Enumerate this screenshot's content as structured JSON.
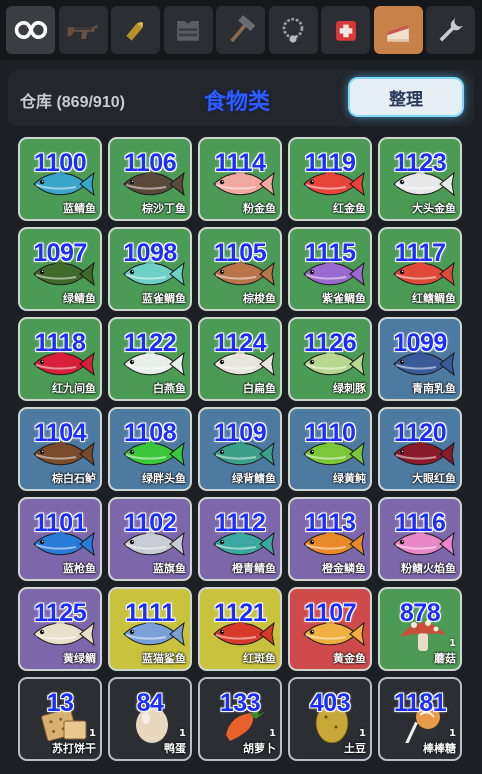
{
  "tabs": [
    {
      "name": "infinity",
      "icon": "infinity-icon"
    },
    {
      "name": "rifle",
      "icon": "rifle-icon"
    },
    {
      "name": "ammo",
      "icon": "bullet-icon"
    },
    {
      "name": "armor",
      "icon": "armor-vest-icon"
    },
    {
      "name": "tool",
      "icon": "hammer-icon"
    },
    {
      "name": "accessory",
      "icon": "necklace-icon"
    },
    {
      "name": "medicine",
      "icon": "medkit-icon"
    },
    {
      "name": "food",
      "icon": "cake-icon",
      "active": true
    },
    {
      "name": "misc",
      "icon": "wrench-icon"
    }
  ],
  "header": {
    "storage": "仓库 (869/910)",
    "category": "食物类",
    "sort_label": "整理"
  },
  "items": [
    {
      "id": "1100",
      "name": "蓝鲭鱼",
      "bg": "green",
      "color": "#3aa7c9"
    },
    {
      "id": "1106",
      "name": "棕沙丁鱼",
      "bg": "green",
      "color": "#5a4a3a"
    },
    {
      "id": "1114",
      "name": "粉金鱼",
      "bg": "green",
      "color": "#f0a8a0"
    },
    {
      "id": "1119",
      "name": "红金鱼",
      "bg": "green",
      "color": "#e8453a"
    },
    {
      "id": "1123",
      "name": "大头金鱼",
      "bg": "green",
      "color": "#e8e8e8"
    },
    {
      "id": "1097",
      "name": "绿鲭鱼",
      "bg": "green",
      "color": "#3f6a2a"
    },
    {
      "id": "1098",
      "name": "蓝雀鲷鱼",
      "bg": "green",
      "color": "#6fd0c8"
    },
    {
      "id": "1105",
      "name": "棕梭鱼",
      "bg": "green",
      "color": "#b8754a"
    },
    {
      "id": "1115",
      "name": "紫雀鲷鱼",
      "bg": "green",
      "color": "#9a6ad0"
    },
    {
      "id": "1117",
      "name": "红鳍鲷鱼",
      "bg": "green",
      "color": "#e04a3a"
    },
    {
      "id": "1118",
      "name": "红九间鱼",
      "bg": "green",
      "color": "#d8203a"
    },
    {
      "id": "1122",
      "name": "白燕鱼",
      "bg": "green",
      "color": "#e8eeea"
    },
    {
      "id": "1124",
      "name": "白扁鱼",
      "bg": "green",
      "color": "#e8e4de"
    },
    {
      "id": "1126",
      "name": "绿刺豚",
      "bg": "green",
      "color": "#b8d890"
    },
    {
      "id": "1099",
      "name": "青南乳鱼",
      "bg": "blue",
      "color": "#3a5a9a"
    },
    {
      "id": "1104",
      "name": "棕白石鲈",
      "bg": "blue",
      "color": "#7a4a2a"
    },
    {
      "id": "1108",
      "name": "绿胖头鱼",
      "bg": "blue",
      "color": "#3ac83a"
    },
    {
      "id": "1109",
      "name": "绿背鳍鱼",
      "bg": "blue",
      "color": "#3aa08a"
    },
    {
      "id": "1110",
      "name": "绿黄鲀",
      "bg": "blue",
      "color": "#7ac83a"
    },
    {
      "id": "1120",
      "name": "大眼红鱼",
      "bg": "blue",
      "color": "#8a1a2a"
    },
    {
      "id": "1101",
      "name": "蓝枪鱼",
      "bg": "purple",
      "color": "#2a7ad8"
    },
    {
      "id": "1102",
      "name": "蓝旗鱼",
      "bg": "purple",
      "color": "#c8ccd4"
    },
    {
      "id": "1112",
      "name": "橙青鲭鱼",
      "bg": "purple",
      "color": "#3aa8a0"
    },
    {
      "id": "1113",
      "name": "橙金鳞鱼",
      "bg": "purple",
      "color": "#e88a2a"
    },
    {
      "id": "1116",
      "name": "粉鳍火焰鱼",
      "bg": "purple",
      "color": "#e888c8"
    },
    {
      "id": "1125",
      "name": "黄绿鲷",
      "bg": "purple",
      "color": "#e8e0c8"
    },
    {
      "id": "1111",
      "name": "蓝猫鲨鱼",
      "bg": "yellow",
      "color": "#7aa0d8"
    },
    {
      "id": "1121",
      "name": "红斑鱼",
      "bg": "yellow",
      "color": "#d83a2a"
    },
    {
      "id": "1107",
      "name": "黄金鱼",
      "bg": "red",
      "color": "#f0b040"
    },
    {
      "id": "878",
      "name": "蘑菇",
      "bg": "green",
      "color": "#c8503a",
      "qty": "1",
      "kind": "mushroom"
    },
    {
      "id": "13",
      "name": "苏打饼干",
      "bg": "dark",
      "color": "#d8b070",
      "qty": "1",
      "kind": "cracker"
    },
    {
      "id": "84",
      "name": "鸭蛋",
      "bg": "dark",
      "color": "#e8d8c0",
      "qty": "1",
      "kind": "egg"
    },
    {
      "id": "133",
      "name": "胡萝卜",
      "bg": "dark",
      "color": "#e8602a",
      "qty": "1",
      "kind": "carrot"
    },
    {
      "id": "403",
      "name": "土豆",
      "bg": "dark",
      "color": "#c8a838",
      "qty": "1",
      "kind": "potato"
    },
    {
      "id": "1181",
      "name": "棒棒糖",
      "bg": "dark",
      "color": "#e89a48",
      "qty": "1",
      "kind": "lollipop"
    }
  ]
}
